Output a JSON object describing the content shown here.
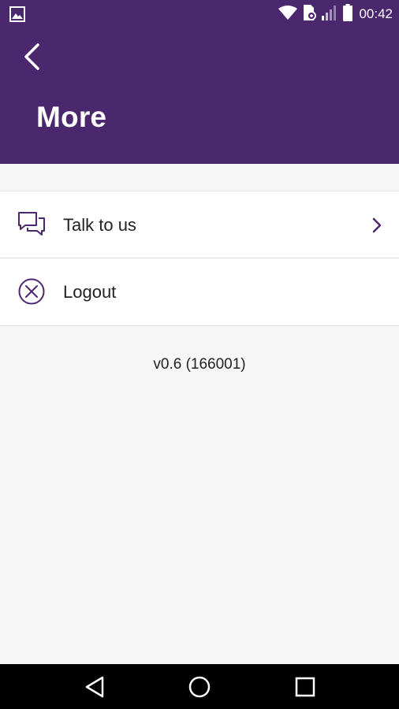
{
  "status_bar": {
    "time": "00:42",
    "icons": [
      "gallery-icon",
      "wifi-icon",
      "data-saver-icon",
      "signal-icon",
      "battery-icon"
    ]
  },
  "header": {
    "title": "More",
    "back_icon": "chevron-left-icon",
    "background_color": "#4b286d"
  },
  "menu": {
    "items": [
      {
        "label": "Talk to us",
        "icon": "chat-bubbles-icon",
        "has_chevron": true
      },
      {
        "label": "Logout",
        "icon": "circle-x-icon",
        "has_chevron": false
      }
    ],
    "accent_color": "#4b286d"
  },
  "footer": {
    "version": "v0.6 (166001)"
  },
  "nav_bar": {
    "buttons": [
      "back-triangle-icon",
      "home-circle-icon",
      "recents-square-icon"
    ]
  }
}
